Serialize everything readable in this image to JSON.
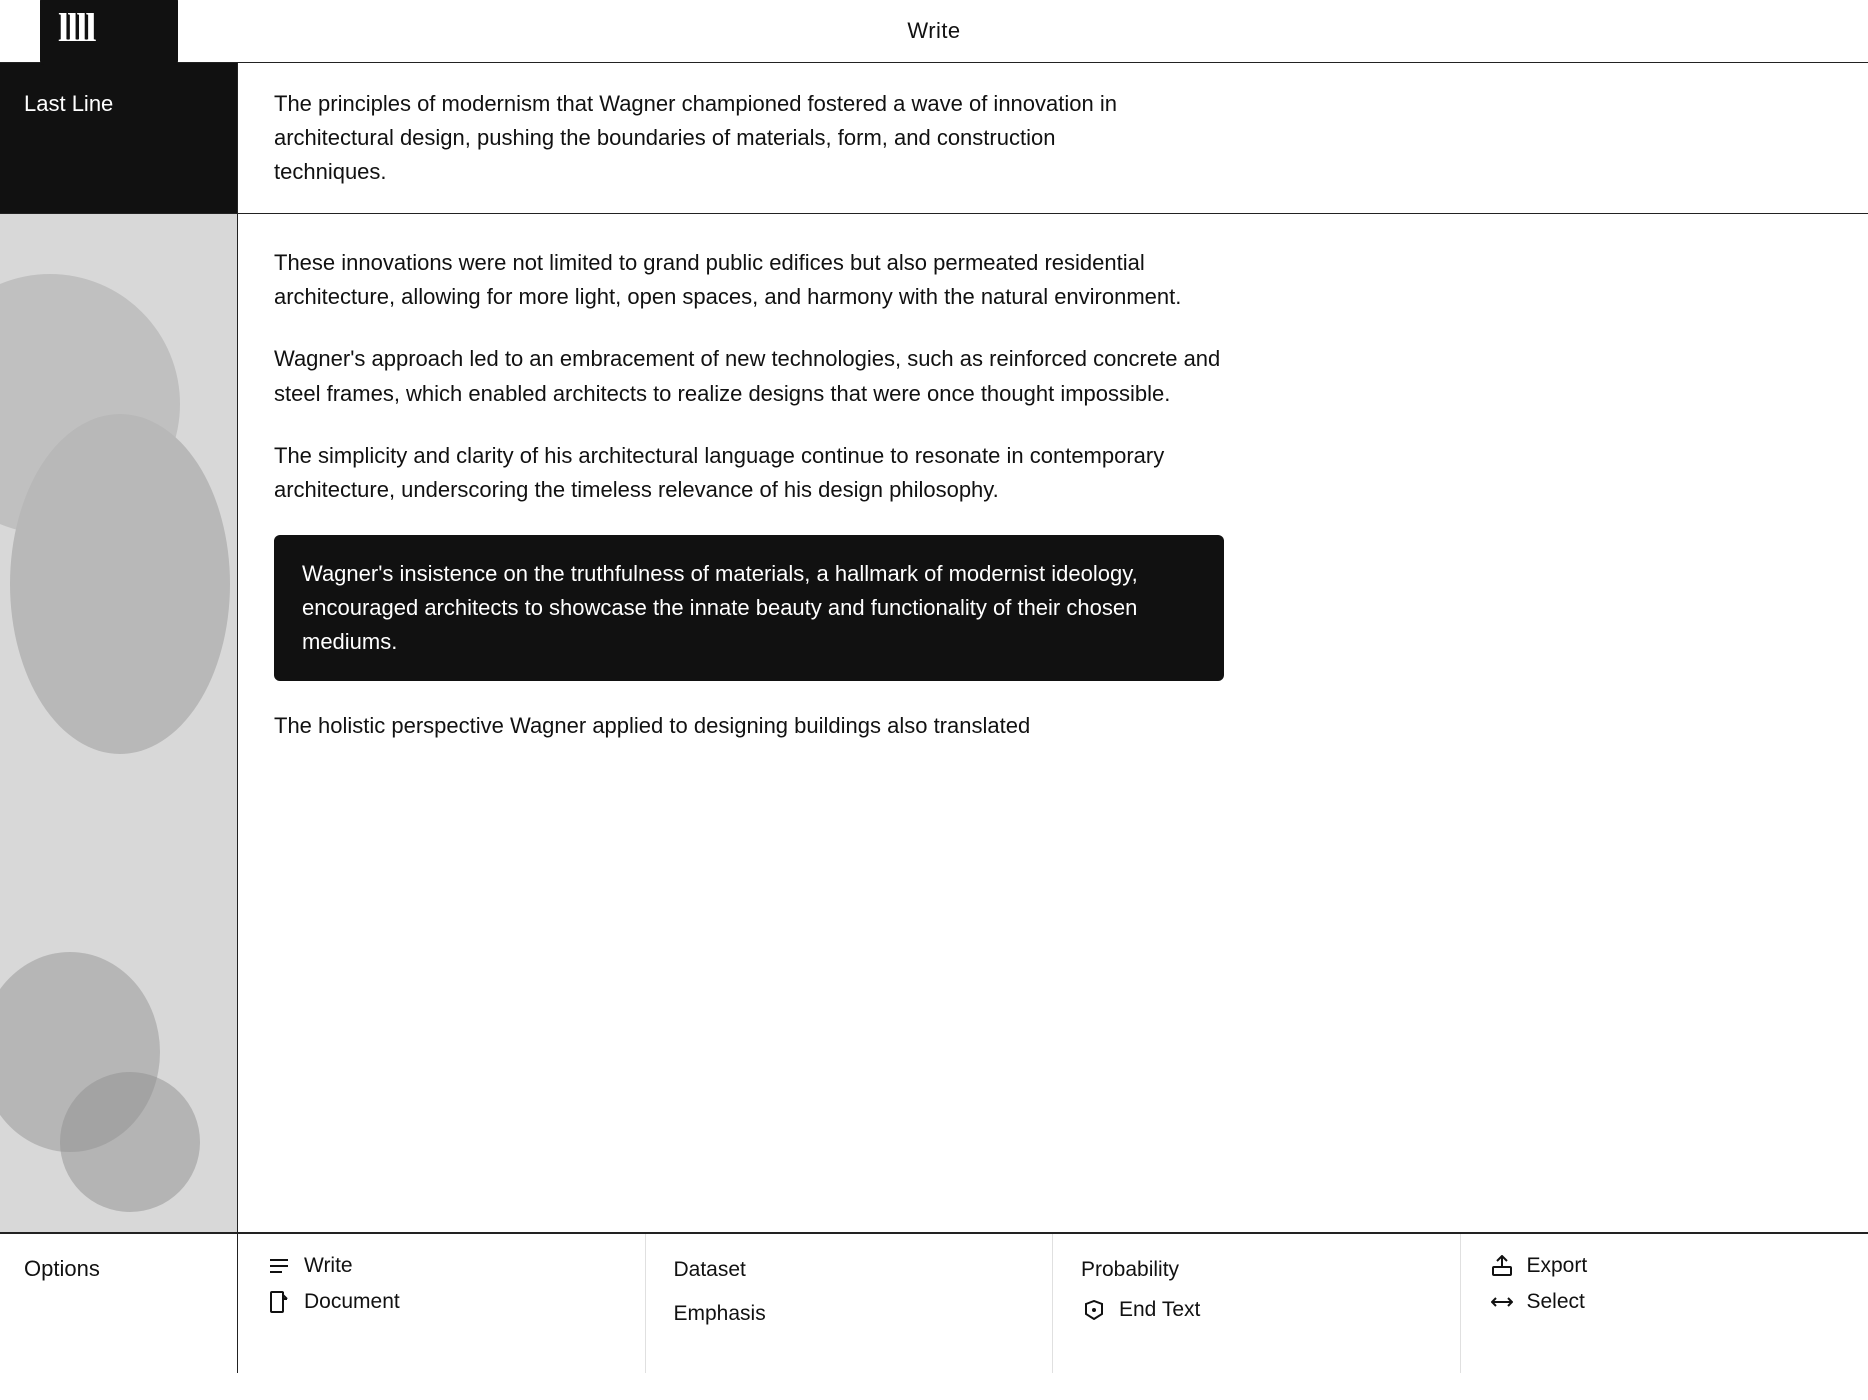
{
  "header": {
    "logo_text": "llll",
    "title": "Write"
  },
  "last_line": {
    "label": "Last Line",
    "text": "The principles of modernism that Wagner championed fostered a wave of innovation in architectural design, pushing the boundaries of materials, form, and construction techniques."
  },
  "article": {
    "paragraphs": [
      "These innovations were not limited to grand public edifices but also permeated residential architecture, allowing for more light, open spaces, and harmony with the natural environment.",
      "Wagner's approach led to an embracement of new technologies, such as reinforced concrete and steel frames, which enabled architects to realize designs that were once thought impossible.",
      "The simplicity and clarity of his architectural language continue to resonate in contemporary architecture, underscoring the timeless relevance of his design philosophy."
    ],
    "highlighted": "Wagner's insistence on the truthfulness of materials, a hallmark of modernist ideology, encouraged architects to showcase the innate beauty and functionality of their chosen mediums.",
    "last_para": "The holistic perspective Wagner applied to designing buildings also translated"
  },
  "options": {
    "label": "Options",
    "columns": [
      {
        "items": [
          {
            "icon": "≡",
            "label": "Write"
          },
          {
            "icon": "☐",
            "label": "Document"
          }
        ]
      },
      {
        "items": [
          {
            "icon": "",
            "label": "Dataset"
          },
          {
            "icon": "",
            "label": "Emphasis"
          }
        ]
      },
      {
        "items": [
          {
            "icon": "",
            "label": "Probability"
          },
          {
            "icon": "⚑",
            "label": "End Text"
          }
        ]
      },
      {
        "items": [
          {
            "icon": "↑□",
            "label": "Export"
          },
          {
            "icon": "↔",
            "label": "Select"
          }
        ]
      }
    ]
  }
}
